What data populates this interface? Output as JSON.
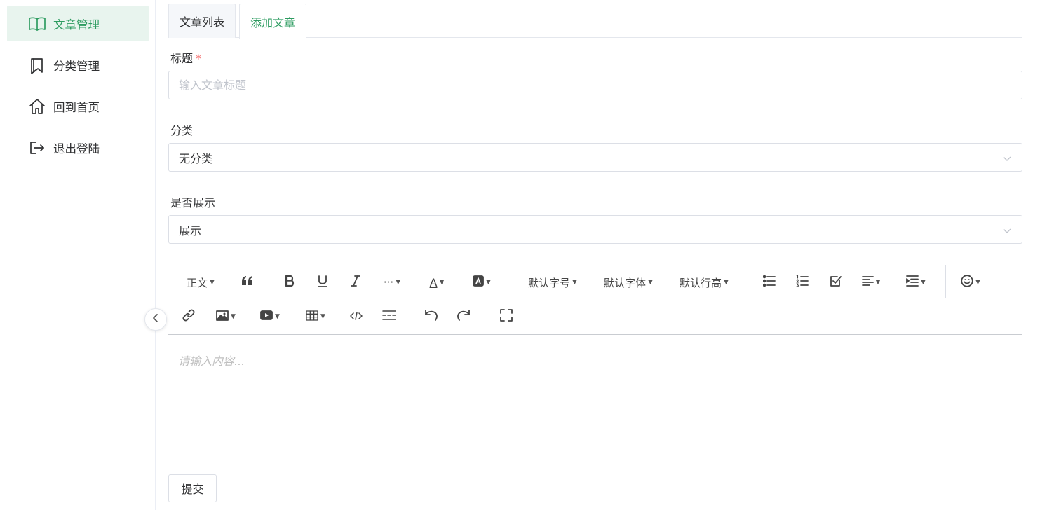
{
  "sidebar": {
    "items": [
      {
        "label": "文章管理",
        "icon": "book-open-icon",
        "active": true
      },
      {
        "label": "分类管理",
        "icon": "bookmarks-icon",
        "active": false
      },
      {
        "label": "回到首页",
        "icon": "home-icon",
        "active": false
      },
      {
        "label": "退出登陆",
        "icon": "logout-icon",
        "active": false
      }
    ]
  },
  "tabs": [
    {
      "label": "文章列表",
      "active": false
    },
    {
      "label": "添加文章",
      "active": true
    }
  ],
  "form": {
    "title_label": "标题",
    "title_required_mark": "*",
    "title_placeholder": "输入文章标题",
    "category_label": "分类",
    "category_value": "无分类",
    "display_label": "是否展示",
    "display_value": "展示",
    "submit_label": "提交"
  },
  "editor": {
    "toolbar": {
      "paragraph": "正文",
      "font_size": "默认字号",
      "font_family": "默认字体",
      "line_height": "默认行高",
      "more": "···",
      "font_color": "A"
    },
    "placeholder": "请输入内容..."
  },
  "colors": {
    "accent": "#2e9c61",
    "active_bg": "#e8f4ee",
    "required": "#f56c6c"
  }
}
